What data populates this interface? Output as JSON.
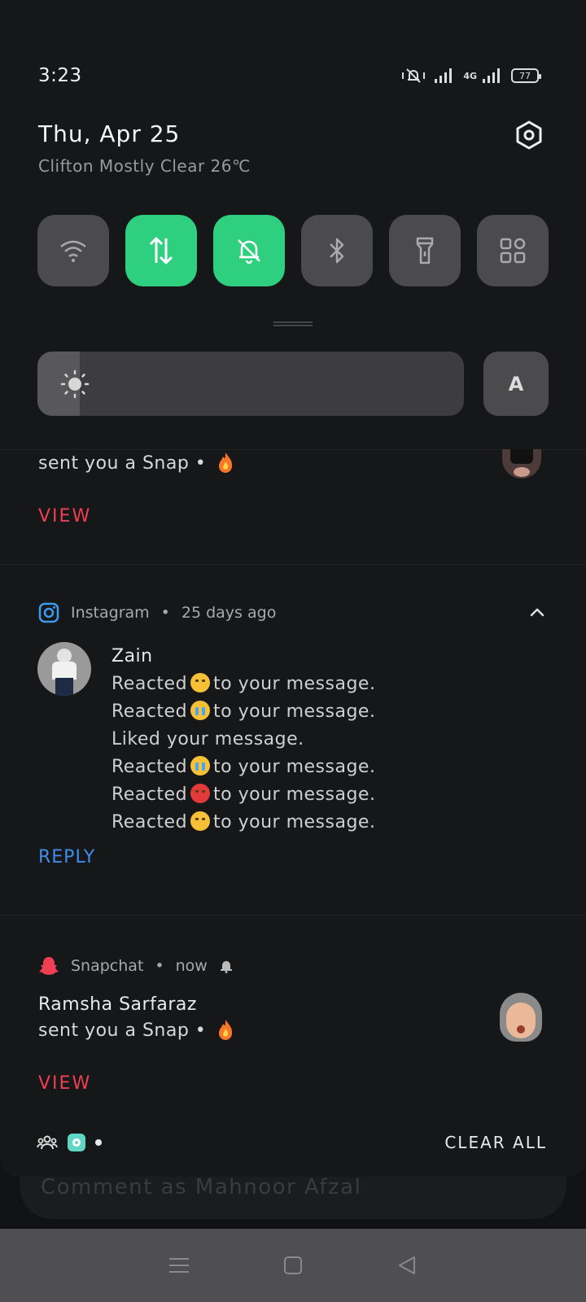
{
  "status_bar": {
    "time": "3:23",
    "network": "4G",
    "battery": "77"
  },
  "header": {
    "date": "Thu, Apr 25",
    "weather": "Clifton Mostly Clear 26℃"
  },
  "quick_tiles": [
    {
      "name": "wifi",
      "icon": "wifi-icon",
      "active": false
    },
    {
      "name": "mobile-data",
      "icon": "data-arrows-icon",
      "active": true
    },
    {
      "name": "silent",
      "icon": "bell-off-icon",
      "active": true
    },
    {
      "name": "bluetooth",
      "icon": "bluetooth-icon",
      "active": false
    },
    {
      "name": "flashlight",
      "icon": "flashlight-icon",
      "active": false
    },
    {
      "name": "more",
      "icon": "grid-icon",
      "active": false
    }
  ],
  "brightness": {
    "level": 0.1,
    "auto_label": "A"
  },
  "notifications": {
    "snap_top": {
      "text": "sent you a Snap •",
      "action": "VIEW"
    },
    "instagram": {
      "app": "Instagram",
      "time": "25 days ago",
      "sender": "Zain",
      "messages": [
        {
          "before": "Reacted",
          "emoji": "smirk",
          "after": "to your message."
        },
        {
          "before": "Reacted",
          "emoji": "cry",
          "after": "to your message."
        },
        {
          "before": "Liked your message.",
          "emoji": "",
          "after": ""
        },
        {
          "before": "Reacted",
          "emoji": "cry",
          "after": "to your message."
        },
        {
          "before": "Reacted",
          "emoji": "angry",
          "after": "to your message."
        },
        {
          "before": "Reacted",
          "emoji": "smirk",
          "after": "to your message."
        }
      ],
      "action": "REPLY"
    },
    "snapchat": {
      "app": "Snapchat",
      "time": "now",
      "sender": "Ramsha Sarfaraz",
      "text": "sent you a Snap •",
      "action": "VIEW"
    }
  },
  "footer": {
    "clear_all": "CLEAR ALL"
  },
  "comment": {
    "placeholder": "Comment as Mahnoor Afzal"
  },
  "colors": {
    "tile_active": "#2ed07f",
    "view_action": "#ef3f52",
    "reply_action": "#3d8eec"
  }
}
